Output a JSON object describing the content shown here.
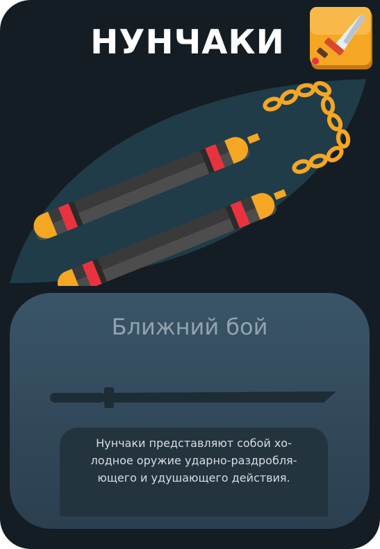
{
  "card": {
    "title": "НУНЧАКИ",
    "category": "Ближний бой",
    "description_lines": [
      "Нунчаки представляют собой хо-",
      "лодное оружие ударно-раздробля-",
      "ющего и удушающего действия."
    ]
  },
  "icons": {
    "badge": "melee-dagger-icon",
    "art": "nunchaku-icon",
    "divider": "sword-silhouette-icon"
  },
  "colors": {
    "card_background": "#141d23",
    "art_leaf": "#1f3c48",
    "panel_top": "#3a5568",
    "panel_bottom": "#2b3f4f",
    "badge_orange": "#f5a623",
    "stick_dark": "#3a3a3a",
    "stick_stripe": "#e8333f",
    "chain": "#f5a623",
    "title_text": "#ffffff",
    "category_text": "#93a3af"
  }
}
